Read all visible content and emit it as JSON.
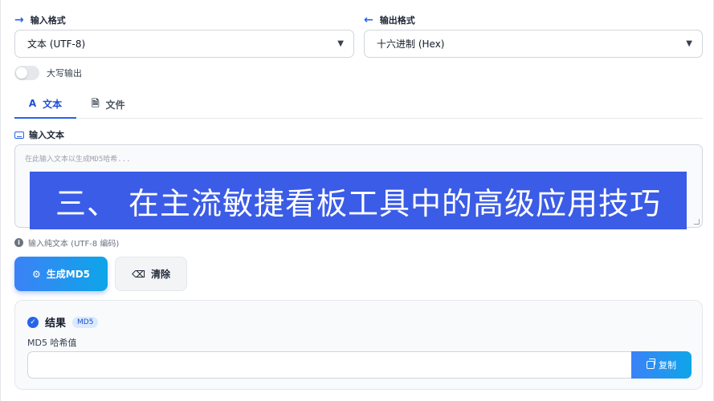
{
  "input_format": {
    "label": "输入格式",
    "arrow": "→",
    "value": "文本 (UTF-8)"
  },
  "output_format": {
    "label": "输出格式",
    "arrow": "←",
    "value": "十六进制 (Hex)"
  },
  "uppercase_toggle": {
    "label": "大写输出",
    "checked": false
  },
  "tabs": [
    {
      "icon": "A",
      "label": "文本",
      "active": true
    },
    {
      "icon": "🗎",
      "label": "文件",
      "active": false
    }
  ],
  "input": {
    "label": "输入文本",
    "placeholder": "在此输入文本以生成MD5哈希...",
    "value": ""
  },
  "banner": "三、 在主流敏捷看板工具中的高级应用技巧",
  "hint": "输入纯文本 (UTF-8 编码)",
  "buttons": {
    "generate": "生成MD5",
    "clear": "清除"
  },
  "result": {
    "title": "结果",
    "badge": "MD5",
    "hash_label": "MD5 哈希值",
    "hash_value": "",
    "copy": "复制"
  },
  "colors": {
    "accent": "#2563eb",
    "banner_bg": "#3b5ce6"
  }
}
